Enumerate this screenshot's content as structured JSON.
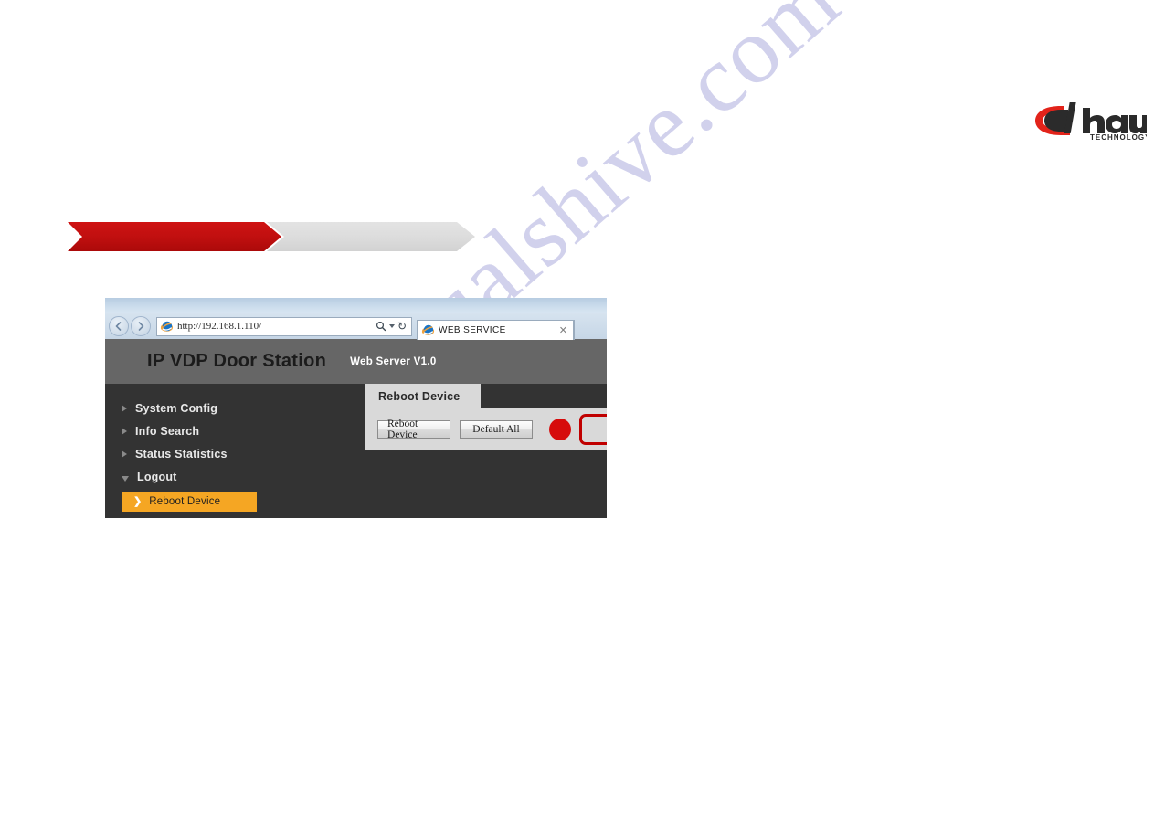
{
  "document": {
    "watermark_text": "manualshive.com",
    "brand": {
      "name": "alhua",
      "tagline": "TECHNOLOGY"
    },
    "banner": {
      "red_segment_label": "",
      "gray_segment_label": ""
    }
  },
  "browser": {
    "back_icon": "back-arrow-icon",
    "forward_icon": "forward-arrow-icon",
    "address": {
      "url": "http://192.168.1.110/",
      "favicon": "internet-explorer-icon",
      "search_icon": "magnifier-icon",
      "dropdown_icon": "chevron-down-icon",
      "refresh_icon": "refresh-icon"
    },
    "tab": {
      "favicon": "internet-explorer-icon",
      "title": "WEB SERVICE",
      "close_label": "✕"
    }
  },
  "webpage": {
    "header": {
      "title": "IP VDP Door Station",
      "subtitle": "Web Server V1.0"
    },
    "sidebar": {
      "items": [
        {
          "label": "System Config",
          "arrow": "triangle-right-icon",
          "expanded": false
        },
        {
          "label": "Info Search",
          "arrow": "triangle-right-icon",
          "expanded": false
        },
        {
          "label": "Status Statistics",
          "arrow": "triangle-right-icon",
          "expanded": false
        },
        {
          "label": "Logout",
          "arrow": "triangle-down-icon",
          "expanded": true
        }
      ],
      "active_subitem": {
        "label": "Reboot Device",
        "chevron": "❯",
        "highlight_color": "#f5a623"
      }
    },
    "content": {
      "tab_label": "Reboot Device",
      "buttons": [
        {
          "label": "Reboot Device"
        },
        {
          "label": "Default All"
        }
      ],
      "annotations": {
        "dot_color": "#d60b0b",
        "box_border_color": "#c00000"
      }
    }
  }
}
